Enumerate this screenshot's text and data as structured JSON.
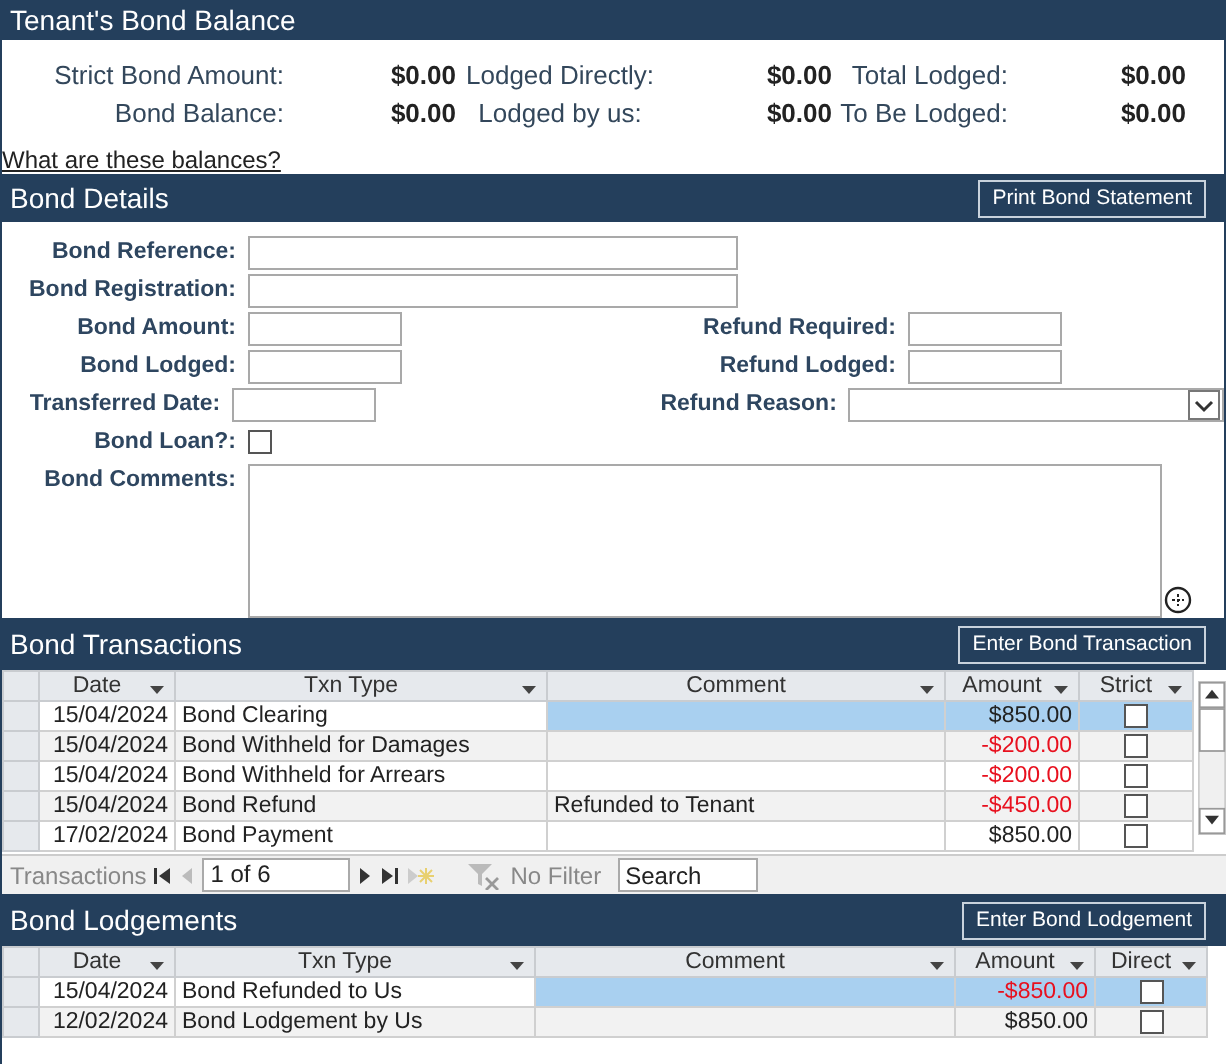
{
  "balance": {
    "title": "Tenant's Bond Balance",
    "rows": [
      [
        {
          "label": "Strict Bond Amount:",
          "value": "$0.00"
        },
        {
          "label": "Lodged Directly:",
          "value": "$0.00"
        },
        {
          "label": "Total Lodged:",
          "value": "$0.00"
        }
      ],
      [
        {
          "label": "Bond Balance:",
          "value": "$0.00"
        },
        {
          "label": "Lodged by us:",
          "value": "$0.00"
        },
        {
          "label": "To Be Lodged:",
          "value": "$0.00"
        }
      ]
    ],
    "link": "What are these balances?"
  },
  "details": {
    "title": "Bond Details",
    "button": "Print Bond Statement",
    "rows": [
      [
        {
          "label": "Bond Reference:",
          "kind": "wide"
        }
      ],
      [
        {
          "label": "Bond Registration:",
          "kind": "wide"
        }
      ],
      [
        {
          "label": "Bond Amount:",
          "kind": "short"
        },
        {
          "label": "Refund Required:",
          "kind": "short"
        }
      ],
      [
        {
          "label": "Bond Lodged:",
          "kind": "short"
        },
        {
          "label": "Refund Lodged:",
          "kind": "short"
        }
      ],
      [
        {
          "label": "Transferred Date:",
          "kind": "short"
        },
        {
          "label": "Refund Reason:",
          "kind": "dropdown"
        }
      ],
      [
        {
          "label": "Bond Loan?:",
          "kind": "checkbox",
          "checked": false
        }
      ],
      [
        {
          "label": "Bond Comments:",
          "kind": "textarea"
        }
      ]
    ]
  },
  "transactions": {
    "title": "Bond Transactions",
    "button": "Enter Bond Transaction",
    "columns": [
      "Date",
      "Txn Type",
      "Comment",
      "Amount",
      "Strict"
    ],
    "rows": [
      {
        "date": "15/04/2024",
        "type": "Bond Clearing",
        "comment": "",
        "amount": "$850.00",
        "negative": false,
        "checked": false,
        "selected": true
      },
      {
        "date": "15/04/2024",
        "type": "Bond Withheld for Damages",
        "comment": "",
        "amount": "-$200.00",
        "negative": true,
        "checked": false,
        "selected": false
      },
      {
        "date": "15/04/2024",
        "type": "Bond Withheld for Arrears",
        "comment": "",
        "amount": "-$200.00",
        "negative": true,
        "checked": false,
        "selected": false
      },
      {
        "date": "15/04/2024",
        "type": "Bond Refund",
        "comment": "Refunded to Tenant",
        "amount": "-$450.00",
        "negative": true,
        "checked": false,
        "selected": false
      },
      {
        "date": "17/02/2024",
        "type": "Bond Payment",
        "comment": "",
        "amount": "$850.00",
        "negative": false,
        "checked": false,
        "selected": false
      }
    ],
    "navigator": {
      "label": "Transactions",
      "record": "1 of 6",
      "filter": "No Filter",
      "search_placeholder": "Search"
    }
  },
  "lodgements": {
    "title": "Bond Lodgements",
    "button": "Enter Bond Lodgement",
    "columns": [
      "Date",
      "Txn Type",
      "Comment",
      "Amount",
      "Direct"
    ],
    "rows": [
      {
        "date": "15/04/2024",
        "type": "Bond Refunded to Us",
        "comment": "",
        "amount": "-$850.00",
        "negative": true,
        "checked": false,
        "selected": true
      },
      {
        "date": "12/02/2024",
        "type": "Bond Lodgement by Us",
        "comment": "",
        "amount": "$850.00",
        "negative": false,
        "checked": false,
        "selected": false
      }
    ]
  }
}
